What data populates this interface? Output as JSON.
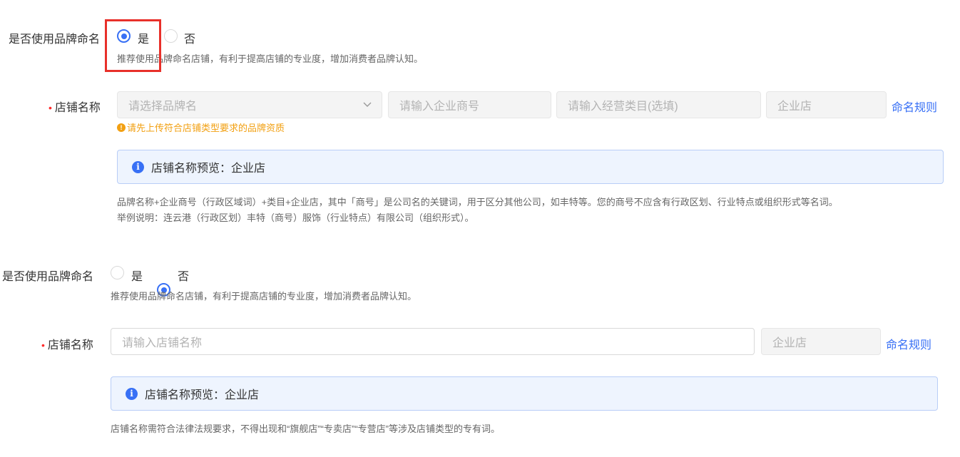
{
  "section1": {
    "brand_label": "是否使用品牌命名",
    "opt_yes": "是",
    "opt_no": "否",
    "selected": "是",
    "brand_hint": "推荐使用品牌命名店铺，有利于提高店铺的专业度，增加消费者品牌认知。",
    "name_label": "店铺名称",
    "required_mark": "•",
    "brand_select_placeholder": "请选择品牌名",
    "company_placeholder": "请输入企业商号",
    "category_placeholder": "请输入经营类目(选填)",
    "suffix_value": "企业店",
    "rule_link": "命名规则",
    "warning_icon": "!",
    "warning_text": "请先上传符合店铺类型要求的品牌资质",
    "info_icon": "i",
    "preview_text": "店铺名称预览：企业店",
    "desc_line1": "品牌名称+企业商号（行政区域词）+类目+企业店，其中「商号」是公司名的关键词，用于区分其他公司，如丰特等。您的商号不应含有行政区划、行业特点或组织形式等名词。",
    "desc_line2": "举例说明：连云港（行政区划）丰特（商号）服饰（行业特点）有限公司（组织形式）。"
  },
  "section2": {
    "brand_label": "是否使用品牌命名",
    "opt_yes": "是",
    "opt_no": "否",
    "selected": "否",
    "brand_hint": "推荐使用品牌命名店铺，有利于提高店铺的专业度，增加消费者品牌认知。",
    "name_label": "店铺名称",
    "required_mark": "•",
    "name_placeholder": "请输入店铺名称",
    "suffix_value": "企业店",
    "rule_link": "命名规则",
    "info_icon": "i",
    "preview_text": "店铺名称预览：企业店",
    "desc_line1": "店铺名称需符合法律法规要求，不得出现和“旗舰店”“专卖店”“专营店”等涉及店铺类型的专有词。"
  },
  "colors": {
    "accent": "#3870f5",
    "required": "#ff2a2a",
    "warning": "#f2a012",
    "highlight": "#e8302a",
    "preview_bg": "#eef4fe"
  }
}
